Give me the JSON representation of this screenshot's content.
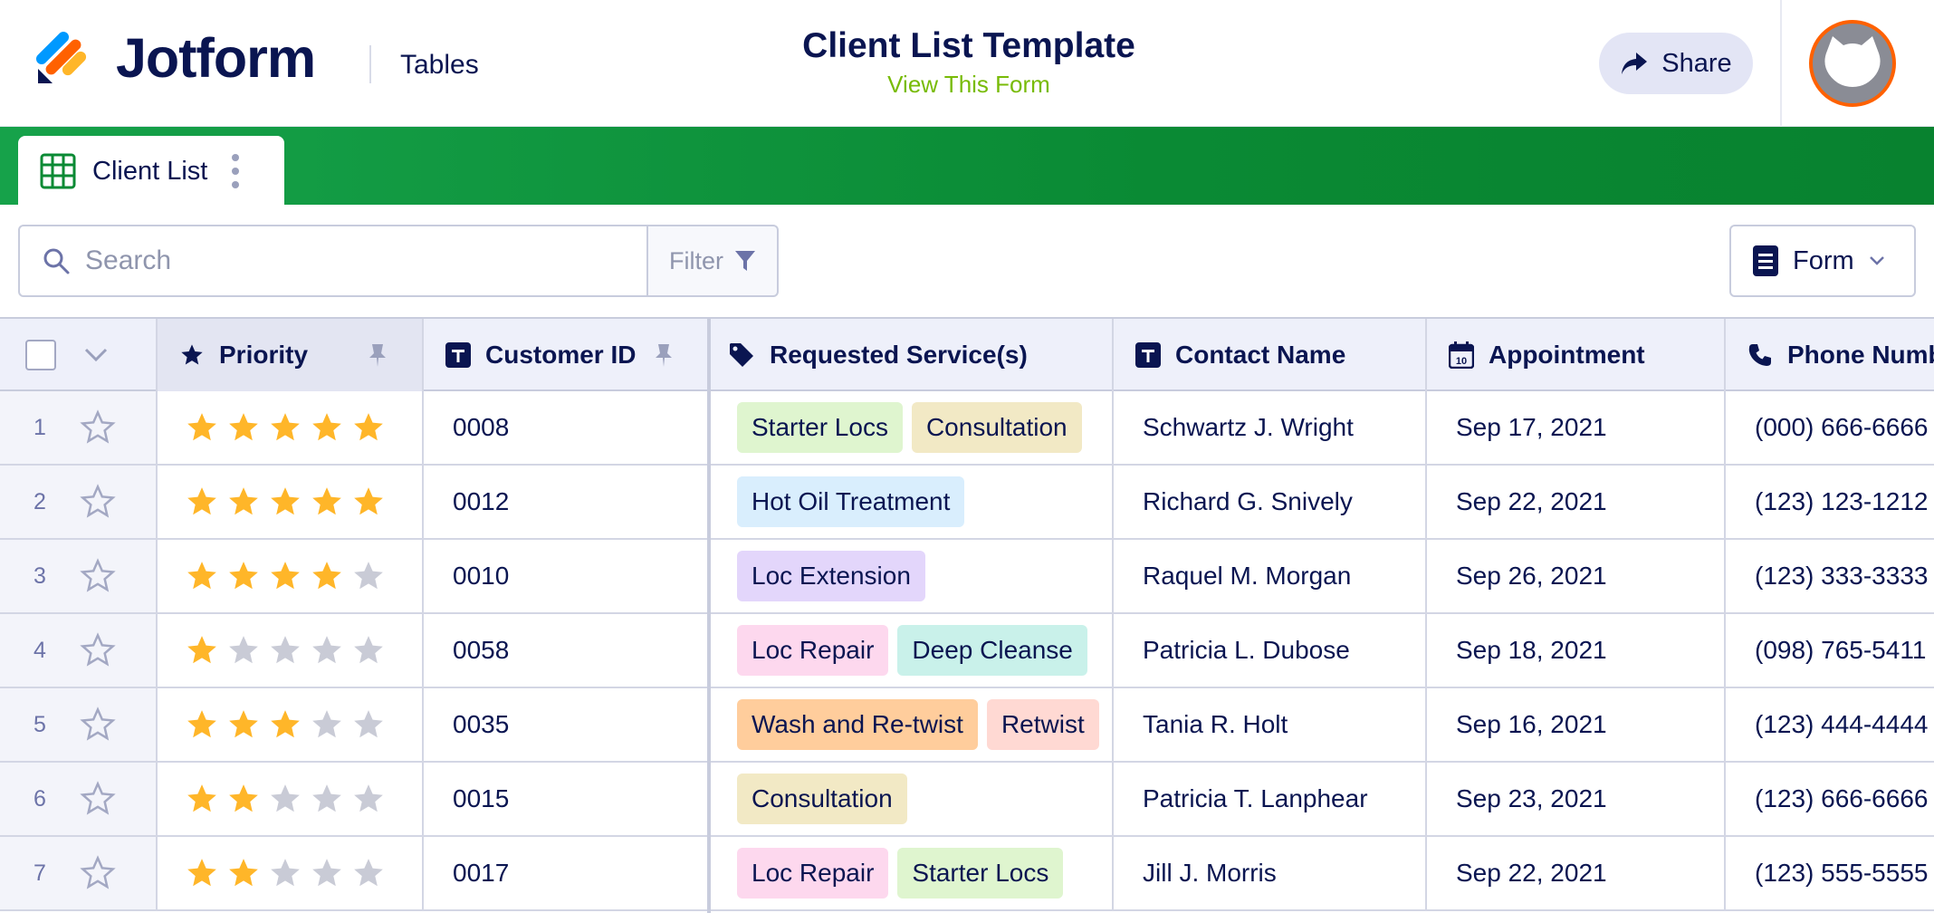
{
  "header": {
    "brand": "Jotform",
    "tables_link": "Tables",
    "form_title": "Client List Template",
    "view_form": "View This Form",
    "share_label": "Share"
  },
  "tab": {
    "label": "Client List"
  },
  "toolbar": {
    "search_placeholder": "Search",
    "filter_label": "Filter",
    "form_label": "Form"
  },
  "columns": [
    "Priority",
    "Customer ID",
    "Requested Service(s)",
    "Contact Name",
    "Appointment",
    "Phone Numb"
  ],
  "rows": [
    {
      "num": "1",
      "rating": 5,
      "id": "0008",
      "services": [
        "Starter Locs",
        "Consultation"
      ],
      "contact": "Schwartz J. Wright",
      "appointment": "Sep 17, 2021",
      "phone": "(000) 666-6666"
    },
    {
      "num": "2",
      "rating": 5,
      "id": "0012",
      "services": [
        "Hot Oil Treatment"
      ],
      "contact": "Richard G. Snively",
      "appointment": "Sep 22, 2021",
      "phone": "(123) 123-1212"
    },
    {
      "num": "3",
      "rating": 4,
      "id": "0010",
      "services": [
        "Loc Extension"
      ],
      "contact": "Raquel M. Morgan",
      "appointment": "Sep 26, 2021",
      "phone": "(123) 333-3333"
    },
    {
      "num": "4",
      "rating": 1,
      "id": "0058",
      "services": [
        "Loc Repair",
        "Deep Cleanse"
      ],
      "contact": "Patricia L. Dubose",
      "appointment": "Sep 18, 2021",
      "phone": "(098) 765-5411"
    },
    {
      "num": "5",
      "rating": 3,
      "id": "0035",
      "services": [
        "Wash and Re-twist",
        "Retwist"
      ],
      "contact": "Tania R. Holt",
      "appointment": "Sep 16, 2021",
      "phone": "(123) 444-4444"
    },
    {
      "num": "6",
      "rating": 2,
      "id": "0015",
      "services": [
        "Consultation"
      ],
      "contact": "Patricia T. Lanphear",
      "appointment": "Sep 23, 2021",
      "phone": "(123) 666-6666"
    },
    {
      "num": "7",
      "rating": 2,
      "id": "0017",
      "services": [
        "Loc Repair",
        "Starter Locs"
      ],
      "contact": "Jill J. Morris",
      "appointment": "Sep 22, 2021",
      "phone": "(123) 555-5555"
    }
  ],
  "tag_colors": {
    "Starter Locs": "#dff5cf",
    "Consultation": "#f2e9c5",
    "Hot Oil Treatment": "#d9eefd",
    "Loc Extension": "#e3d6fb",
    "Loc Repair": "#fdd8ee",
    "Deep Cleanse": "#c9f1ea",
    "Wash and Re-twist": "#ffcd9c",
    "Retwist": "#ffd9d3"
  },
  "colors": {
    "accent_green": "#0a8a34",
    "star_filled": "#ffb629",
    "star_empty": "#c9cbd6",
    "link_green": "#78bb07"
  }
}
